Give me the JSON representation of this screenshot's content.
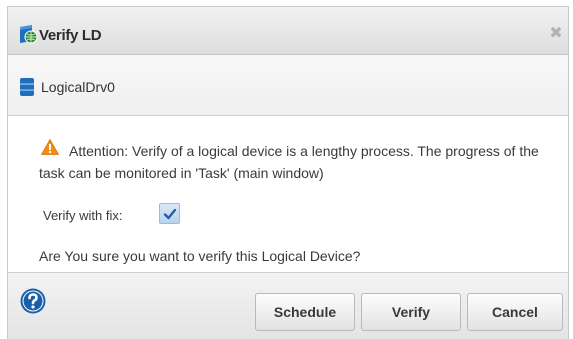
{
  "dialog": {
    "title": "Verify LD",
    "close_glyph": "✖",
    "title_icon": "shield-globe-icon",
    "accent_color": "#1f6fbf"
  },
  "device": {
    "name": "LogicalDrv0",
    "icon": "database-icon"
  },
  "content": {
    "warning_icon": "warning-triangle-icon",
    "attention_text": "Attention: Verify of a logical device is a lengthy process. The progress of the task can be monitored in 'Task' (main window)",
    "verify_with_fix_label": "Verify with fix:",
    "verify_with_fix_checked": true,
    "confirm_question": "Are You sure you want to verify this Logical Device?"
  },
  "footer": {
    "help_icon": "question-circle-icon",
    "schedule_label": "Schedule",
    "verify_label": "Verify",
    "cancel_label": "Cancel"
  }
}
